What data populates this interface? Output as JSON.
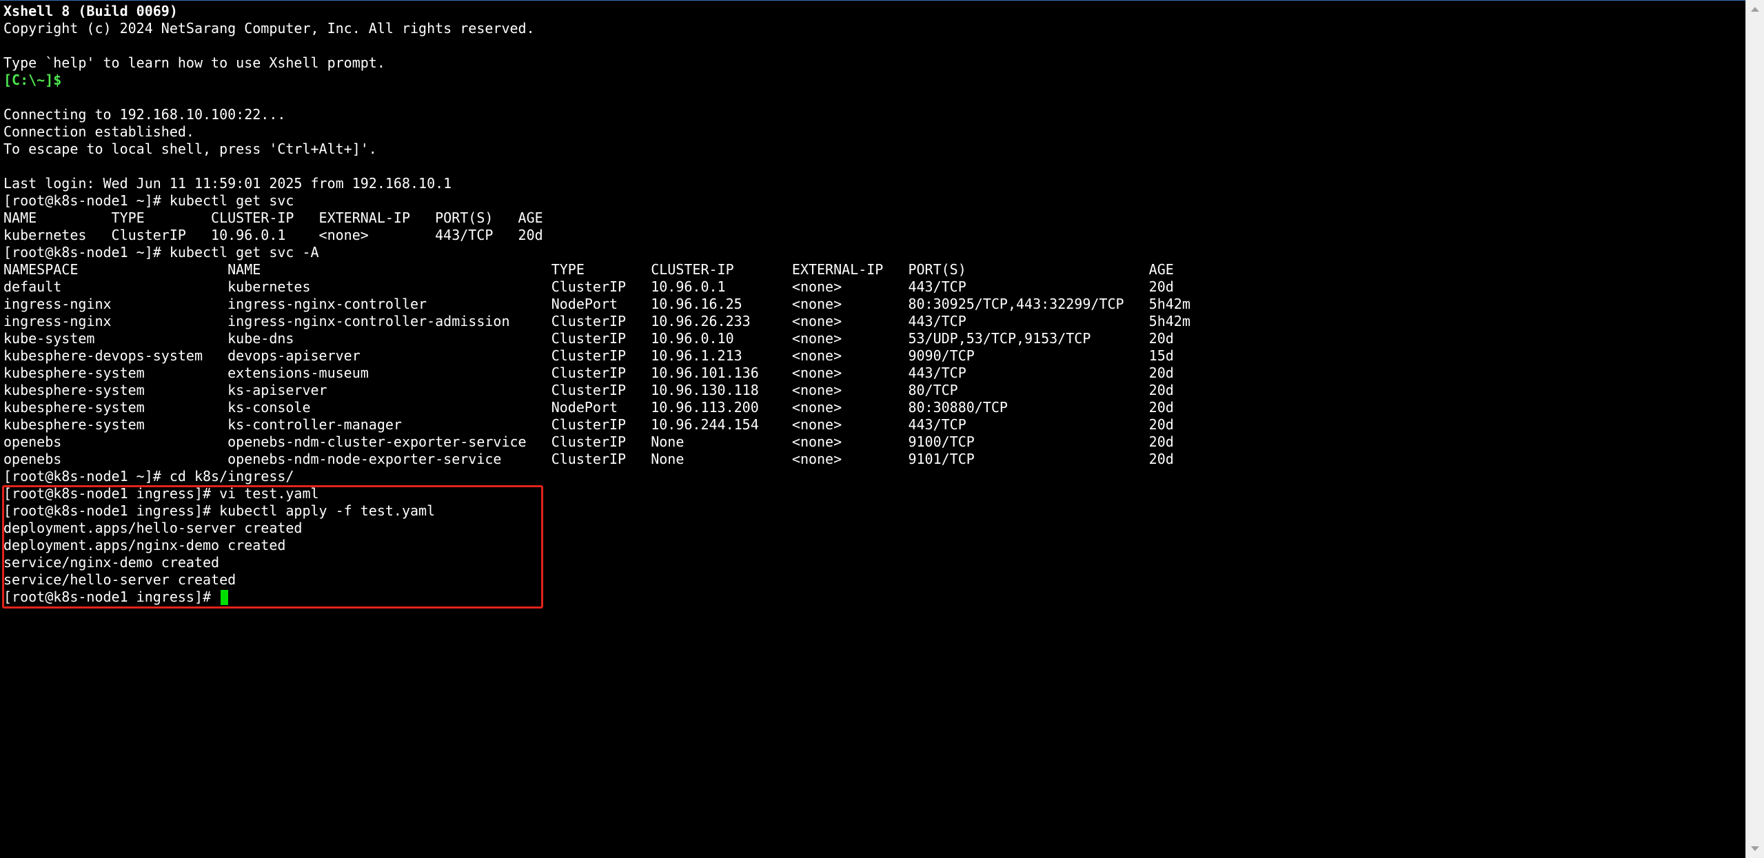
{
  "terminal": {
    "lines": [
      "Xshell 8 (Build 0069)",
      "Copyright (c) 2024 NetSarang Computer, Inc. All rights reserved.",
      "",
      "Type `help' to learn how to use Xshell prompt.",
      "[C:\\~]$",
      "",
      "Connecting to 192.168.10.100:22...",
      "Connection established.",
      "To escape to local shell, press 'Ctrl+Alt+]'.",
      "",
      "Last login: Wed Jun 11 11:59:01 2025 from 192.168.10.1",
      "[root@k8s-node1 ~]# kubectl get svc",
      "NAME         TYPE        CLUSTER-IP   EXTERNAL-IP   PORT(S)   AGE",
      "kubernetes   ClusterIP   10.96.0.1    <none>        443/TCP   20d",
      "[root@k8s-node1 ~]# kubectl get svc -A",
      "NAMESPACE                  NAME                                   TYPE        CLUSTER-IP       EXTERNAL-IP   PORT(S)                      AGE",
      "default                    kubernetes                             ClusterIP   10.96.0.1        <none>        443/TCP                      20d",
      "ingress-nginx              ingress-nginx-controller               NodePort    10.96.16.25      <none>        80:30925/TCP,443:32299/TCP   5h42m",
      "ingress-nginx              ingress-nginx-controller-admission     ClusterIP   10.96.26.233     <none>        443/TCP                      5h42m",
      "kube-system                kube-dns                               ClusterIP   10.96.0.10       <none>        53/UDP,53/TCP,9153/TCP       20d",
      "kubesphere-devops-system   devops-apiserver                       ClusterIP   10.96.1.213      <none>        9090/TCP                     15d",
      "kubesphere-system          extensions-museum                      ClusterIP   10.96.101.136    <none>        443/TCP                      20d",
      "kubesphere-system          ks-apiserver                           ClusterIP   10.96.130.118    <none>        80/TCP                       20d",
      "kubesphere-system          ks-console                             NodePort    10.96.113.200    <none>        80:30880/TCP                 20d",
      "kubesphere-system          ks-controller-manager                  ClusterIP   10.96.244.154    <none>        443/TCP                      20d",
      "openebs                    openebs-ndm-cluster-exporter-service   ClusterIP   None             <none>        9100/TCP                     20d",
      "openebs                    openebs-ndm-node-exporter-service      ClusterIP   None             <none>        9101/TCP                     20d",
      "[root@k8s-node1 ~]# cd k8s/ingress/",
      "[root@k8s-node1 ingress]# vi test.yaml",
      "[root@k8s-node1 ingress]# kubectl apply -f test.yaml",
      "deployment.apps/hello-server created",
      "deployment.apps/nginx-demo created",
      "service/nginx-demo created",
      "service/hello-server created",
      "[root@k8s-node1 ingress]# "
    ],
    "colors": {
      "background": "#000000",
      "text": "#ffffff",
      "prompt_local": "#4ee44e",
      "cursor": "#00e000",
      "highlight_border": "#e2231a"
    }
  }
}
